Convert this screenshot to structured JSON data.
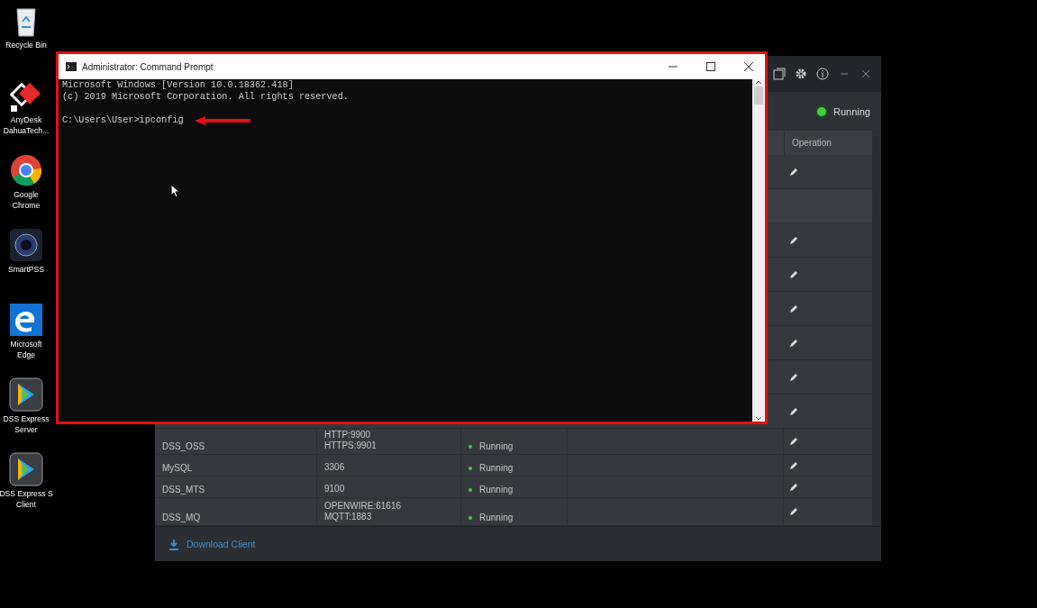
{
  "desktop_icons": [
    {
      "kind": "bin",
      "lines": [
        "Recycle Bin"
      ]
    },
    {
      "kind": "anydesk",
      "lines": [
        "AnyDesk",
        "DahuaTech..."
      ]
    },
    {
      "kind": "chrome",
      "lines": [
        "Google",
        "Chrome"
      ]
    },
    {
      "kind": "smartpss",
      "lines": [
        "SmartPSS"
      ]
    },
    {
      "kind": "edge",
      "lines": [
        "Microsoft",
        "Edge"
      ]
    },
    {
      "kind": "dss",
      "lines": [
        "DSS Express",
        "Server"
      ]
    },
    {
      "kind": "dss",
      "lines": [
        "DSS Express S",
        "Client"
      ]
    }
  ],
  "server_window": {
    "status": {
      "label": "Running",
      "on": true
    },
    "operation_header": "Operation",
    "rows": [
      {
        "editable": true
      },
      {
        "editable": false
      },
      {
        "editable": true
      },
      {
        "editable": true
      },
      {
        "editable": true
      },
      {
        "editable": true
      },
      {
        "editable": true
      },
      {
        "editable": true
      },
      {
        "name": "DSS_OSS",
        "ports": [
          "HTTP:9900",
          "HTTPS:9901"
        ],
        "status": "Running",
        "running": true,
        "editable": true
      },
      {
        "name": "MySQL",
        "ports": [
          "3306"
        ],
        "status": "Running",
        "running": true,
        "editable": true
      },
      {
        "name": "DSS_MTS",
        "ports": [
          "9100"
        ],
        "status": "Running",
        "running": true,
        "editable": true
      },
      {
        "name": "DSS_MQ",
        "ports": [
          "OPENWIRE:61616",
          "MQTT:1883"
        ],
        "status": "Running",
        "running": true,
        "editable": true
      }
    ],
    "download_link": "Download Client"
  },
  "cmd_window": {
    "title": "Administrator: Command Prompt",
    "lines": [
      "Microsoft Windows [Version 10.0.18362.418]",
      "(c) 2019 Microsoft Corporation. All rights reserved."
    ],
    "prompt": "C:\\Users\\User>ipconfig"
  }
}
